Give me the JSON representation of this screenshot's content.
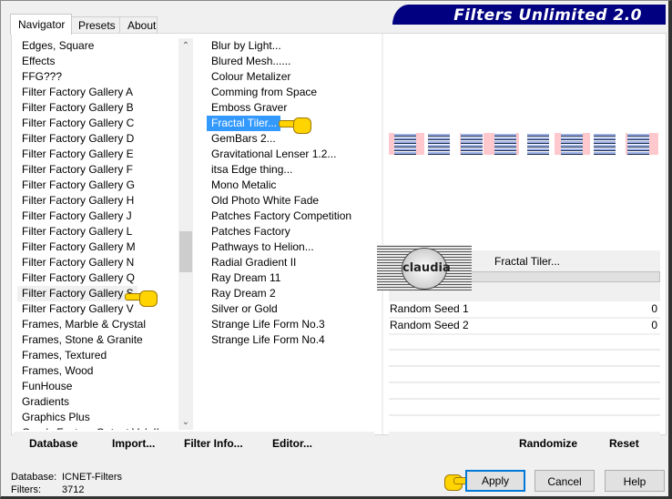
{
  "window": {
    "title": "Filters Unlimited 2.0"
  },
  "tabs": [
    {
      "label": "Navigator",
      "active": true
    },
    {
      "label": "Presets",
      "active": false
    },
    {
      "label": "About",
      "active": false
    }
  ],
  "categories": {
    "selected": "Filter Factory Gallery S",
    "items": [
      "Edges, Square",
      "Effects",
      "FFG???",
      "Filter Factory Gallery A",
      "Filter Factory Gallery B",
      "Filter Factory Gallery C",
      "Filter Factory Gallery D",
      "Filter Factory Gallery E",
      "Filter Factory Gallery F",
      "Filter Factory Gallery G",
      "Filter Factory Gallery H",
      "Filter Factory Gallery J",
      "Filter Factory Gallery L",
      "Filter Factory Gallery M",
      "Filter Factory Gallery N",
      "Filter Factory Gallery Q",
      "Filter Factory Gallery S",
      "Filter Factory Gallery V",
      "Frames, Marble & Crystal",
      "Frames, Stone & Granite",
      "Frames, Textured",
      "Frames, Wood",
      "FunHouse",
      "Gradients",
      "Graphics Plus",
      "Greg's Factory Output Vol. II"
    ]
  },
  "filters": {
    "selected": "Fractal Tiler...",
    "items": [
      "Blur by Light...",
      "Blured Mesh......",
      "Colour Metalizer",
      "Comming from Space",
      "Emboss Graver",
      "Fractal Tiler...",
      "GemBars 2...",
      "Gravitational Lenser 1.2...",
      "itsa Edge thing...",
      "Mono Metalic",
      "Old Photo White Fade",
      "Patches Factory Competition",
      "Patches Factory",
      "Pathways to Helion...",
      "Radial Gradient II",
      "Ray Dream 11",
      "Ray Dream 2",
      "Silver or Gold",
      "Strange Life Form No.3",
      "Strange Life Form No.4"
    ]
  },
  "filter_panel": {
    "name": "Fractal Tiler...",
    "logo_text": "claudia",
    "params": [
      {
        "label": "Random Seed 1",
        "value": "0"
      },
      {
        "label": "Random Seed 2",
        "value": "0"
      }
    ]
  },
  "toolbar_left": {
    "database": "Database",
    "import": "Import...",
    "filter_info": "Filter Info...",
    "editor": "Editor..."
  },
  "toolbar_right": {
    "randomize": "Randomize",
    "reset": "Reset"
  },
  "status": {
    "database_label": "Database:",
    "database_value": "ICNET-Filters",
    "filters_label": "Filters:",
    "filters_value": "3712"
  },
  "buttons": {
    "apply": "Apply",
    "cancel": "Cancel",
    "help": "Help"
  },
  "colors": {
    "title_bg": "#000080",
    "selection_blue": "#3399ff",
    "default_button_border": "#0078d7",
    "preview_pink": "#ffc8cc"
  }
}
